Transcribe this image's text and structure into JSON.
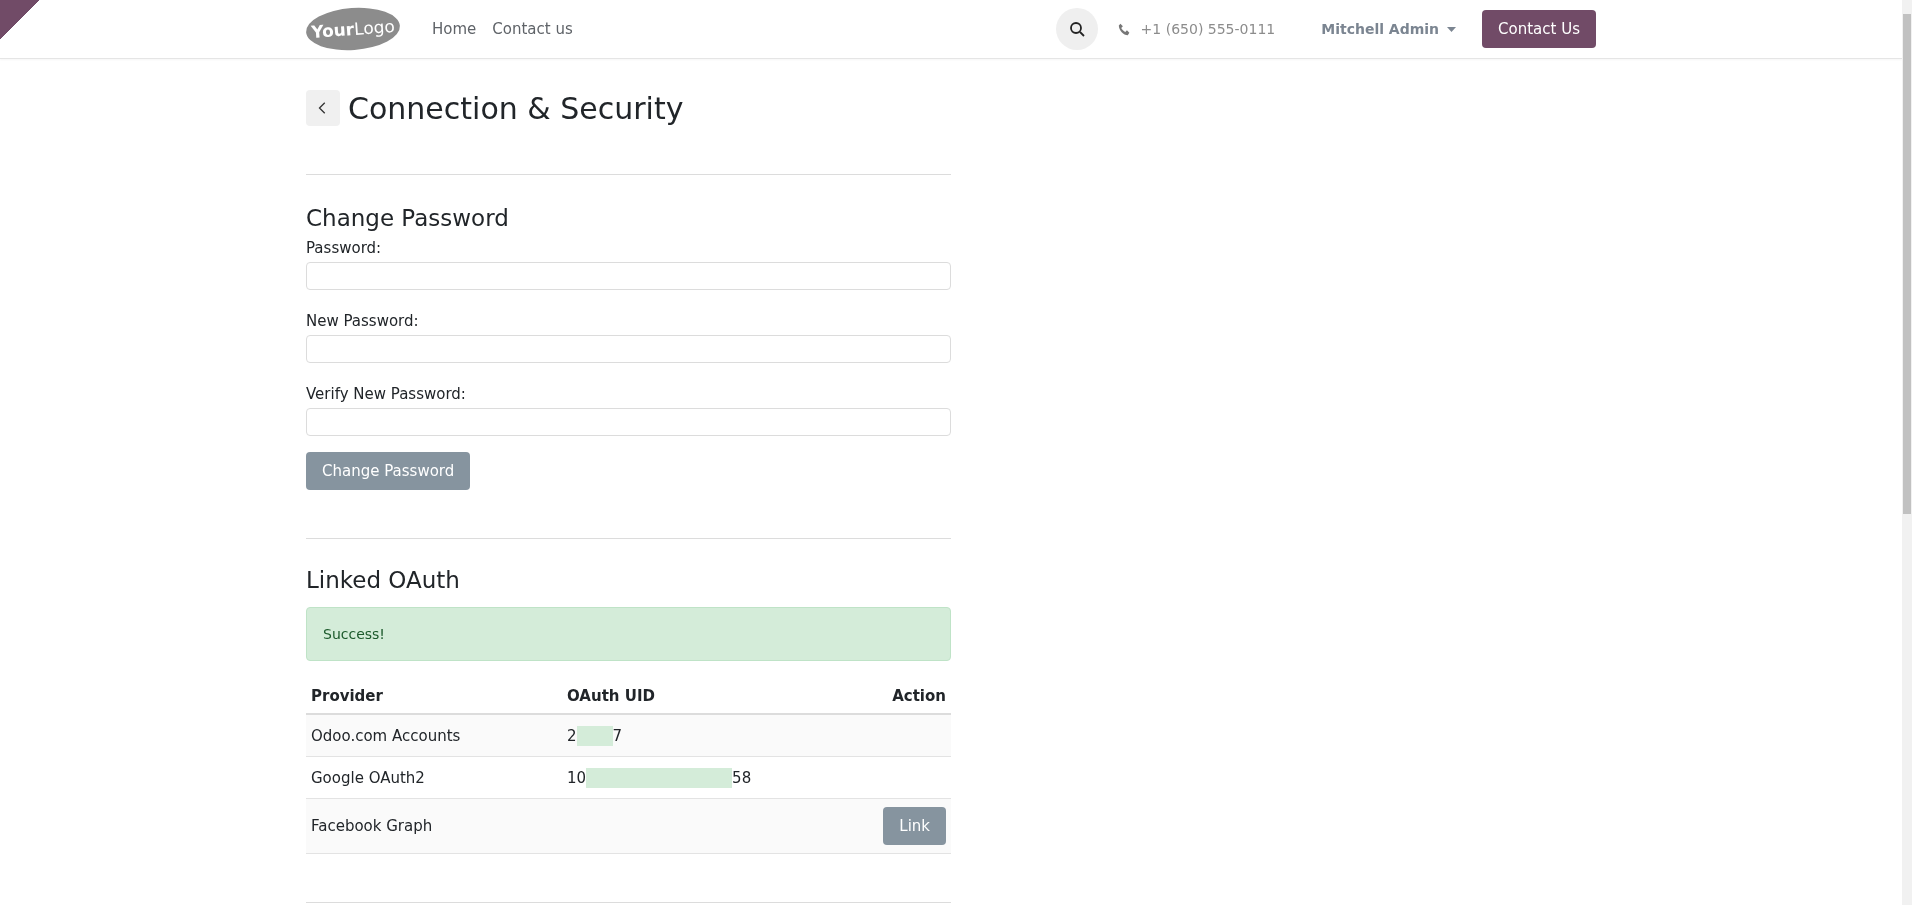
{
  "navbar": {
    "logo": {
      "part_1": "Your",
      "part_2": "Logo"
    },
    "links": [
      {
        "label": "Home",
        "selected": false
      },
      {
        "label": "Contact us",
        "selected": false
      }
    ],
    "phone": "+1 (650) 555-0111",
    "user": "Mitchell Admin",
    "cta": "Contact Us"
  },
  "page": {
    "title": "Connection & Security"
  },
  "change_password": {
    "heading": "Change Password",
    "fields": [
      {
        "label": "Password:"
      },
      {
        "label": "New Password:"
      },
      {
        "label": "Verify New Password:"
      }
    ],
    "button": "Change Password"
  },
  "linked_oauth": {
    "heading": "Linked OAuth",
    "alert": "Success!",
    "columns": [
      "Provider",
      "OAuth UID",
      "Action"
    ],
    "rows": [
      {
        "provider": "Odoo.com Accounts",
        "uid_start": "2",
        "uid_end": "7",
        "action": null
      },
      {
        "provider": "Google OAuth2",
        "uid_start": "10",
        "uid_end": "58",
        "action": null
      },
      {
        "provider": "Facebook Graph",
        "action": "Link"
      }
    ]
  }
}
